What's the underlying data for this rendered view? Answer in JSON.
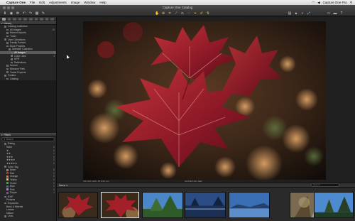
{
  "menubar": {
    "items": [
      "Capture One",
      "File",
      "Edit",
      "Adjustments",
      "Image",
      "Window",
      "Help"
    ],
    "right_text": "Capture One Pro"
  },
  "window": {
    "title": "Capture One Catalog"
  },
  "left_panel": {
    "library_header": "Library",
    "catalog_collection": "Catalog Collection",
    "all_images": "All Images",
    "all_images_count": "15",
    "recent_imports": "Recent Imports",
    "trash": "Trash",
    "user_collections": "User Collections",
    "tree": [
      "Family Portrait",
      "Book Projects",
      "Selected Collection",
      "All Images",
      "Color Labs",
      "NPR",
      "Reflections",
      "Sunset",
      "Blossom Park",
      "Travel Projects"
    ],
    "tree_counts": {
      "All Images": "9",
      "Color Labs": "3"
    },
    "folders_header": "Folders",
    "folders_item": "Catalog",
    "filters_header": "Filters",
    "filter_search_placeholder": "Search",
    "rating_header": "Rating",
    "rating_rows": [
      "None",
      "★",
      "★★",
      "★★★",
      "★★★★",
      "★★★★★"
    ],
    "rating_counts": [
      "0",
      "6",
      "1",
      "0",
      "2",
      "0"
    ],
    "color_tag_header": "Color Tag",
    "color_tags": [
      {
        "name": "None",
        "color": "#8a8a8a",
        "count": "8"
      },
      {
        "name": "Red",
        "color": "#d0302c",
        "count": "0"
      },
      {
        "name": "Orange",
        "color": "#e07d24",
        "count": "0"
      },
      {
        "name": "Yellow",
        "color": "#e0cb2c",
        "count": "0"
      },
      {
        "name": "Green",
        "color": "#3ea64a",
        "count": "0"
      },
      {
        "name": "Blue",
        "color": "#3366cc",
        "count": "0"
      },
      {
        "name": "Pink",
        "color": "#d66fb1",
        "count": "0"
      },
      {
        "name": "Purple",
        "color": "#7e4fb0",
        "count": "1"
      }
    ],
    "extra_rows": [
      "EXIF",
      "Keywords",
      "Lens"
    ],
    "keyword_rows": [
      "Pictures",
      "Bank & Wheels",
      "Leaves",
      "Nature",
      "Cars"
    ]
  },
  "viewer": {
    "status_left": "ISO 200   1/80 s   f/5.6   60 mm",
    "status_center": "SUNSET-001.NEF"
  },
  "browser": {
    "label": "Name",
    "search_placeholder": "Search",
    "thumb_count": 7,
    "selected_index": 1
  },
  "colors": {
    "accent_yellow": "#e8c14a",
    "selection": "#5b5b5b",
    "leaf_red": "#a3202a"
  }
}
